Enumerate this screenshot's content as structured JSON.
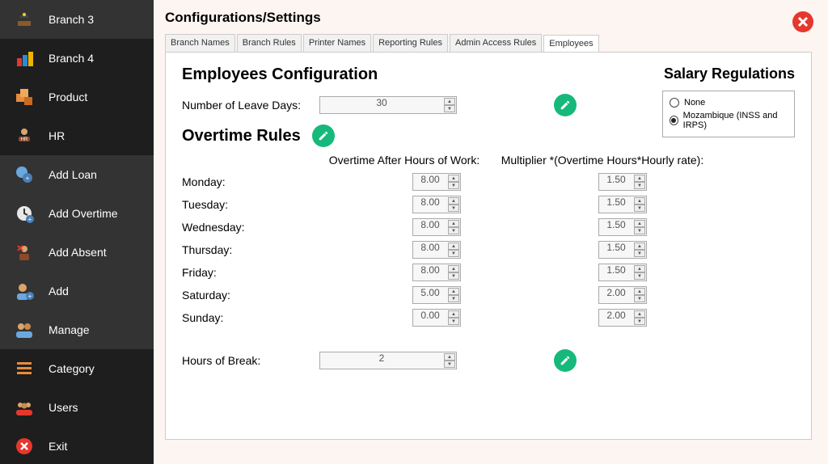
{
  "sidebar": {
    "items": [
      {
        "label": "Branch 3"
      },
      {
        "label": "Branch 4"
      },
      {
        "label": "Product"
      },
      {
        "label": "HR"
      },
      {
        "label": "Add Loan"
      },
      {
        "label": "Add Overtime"
      },
      {
        "label": "Add Absent"
      },
      {
        "label": "Add"
      },
      {
        "label": "Manage"
      },
      {
        "label": "Category"
      },
      {
        "label": "Users"
      },
      {
        "label": "Exit"
      }
    ]
  },
  "page": {
    "title": "Configurations/Settings"
  },
  "tabs": [
    {
      "label": "Branch Names"
    },
    {
      "label": "Branch Rules"
    },
    {
      "label": "Printer Names"
    },
    {
      "label": "Reporting Rules"
    },
    {
      "label": "Admin Access Rules"
    },
    {
      "label": "Employees"
    }
  ],
  "employees": {
    "section_title": "Employees Configuration",
    "leave_days_label": "Number of Leave Days:",
    "leave_days_value": "30",
    "overtime": {
      "title": "Overtime Rules",
      "header_after": "Overtime After Hours of Work:",
      "header_multiplier": "Multiplier *(Overtime Hours*Hourly rate):",
      "days": [
        {
          "name": "Monday:",
          "hours": "8.00",
          "multiplier": "1.50"
        },
        {
          "name": "Tuesday:",
          "hours": "8.00",
          "multiplier": "1.50"
        },
        {
          "name": "Wednesday:",
          "hours": "8.00",
          "multiplier": "1.50"
        },
        {
          "name": "Thursday:",
          "hours": "8.00",
          "multiplier": "1.50"
        },
        {
          "name": "Friday:",
          "hours": "8.00",
          "multiplier": "1.50"
        },
        {
          "name": "Saturday:",
          "hours": "5.00",
          "multiplier": "2.00"
        },
        {
          "name": "Sunday:",
          "hours": "0.00",
          "multiplier": "2.00"
        }
      ]
    },
    "break_label": "Hours of Break:",
    "break_value": "2"
  },
  "salary": {
    "title": "Salary Regulations",
    "options": [
      {
        "label": "None",
        "checked": false
      },
      {
        "label": "Mozambique (INSS and IRPS)",
        "checked": true
      }
    ]
  }
}
